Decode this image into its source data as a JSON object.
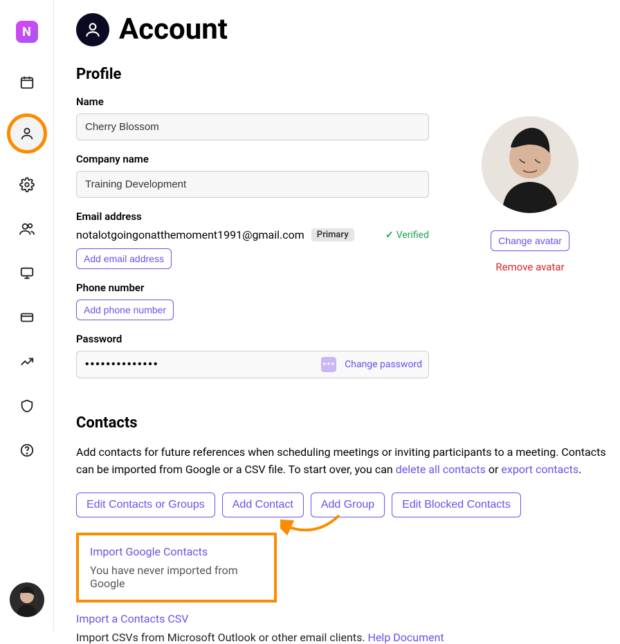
{
  "app": {
    "logo_letter": "N"
  },
  "page": {
    "title": "Account"
  },
  "profile": {
    "heading": "Profile",
    "name_label": "Name",
    "name_value": "Cherry Blossom",
    "company_label": "Company name",
    "company_value": "Training Development",
    "email_label": "Email address",
    "email_value": "notalotgoingonatthemoment1991@gmail.com",
    "email_badge": "Primary",
    "email_verified": "Verified",
    "add_email": "Add email address",
    "phone_label": "Phone number",
    "add_phone": "Add phone number",
    "password_label": "Password",
    "password_mask": "••••••••••••••",
    "change_password": "Change password",
    "change_avatar": "Change avatar",
    "remove_avatar": "Remove avatar"
  },
  "contacts": {
    "heading": "Contacts",
    "desc_part1": "Add contacts for future references when scheduling meetings or inviting participants to a meeting. Contacts can be imported from Google or a CSV file. To start over, you can ",
    "delete_link": "delete all contacts",
    "desc_part2": " or ",
    "export_link": "export contacts",
    "desc_part3": ".",
    "btn_edit": "Edit Contacts or Groups",
    "btn_add_contact": "Add Contact",
    "btn_add_group": "Add Group",
    "btn_blocked": "Edit Blocked Contacts",
    "import_google": "Import Google Contacts",
    "import_google_sub": "You have never imported from Google",
    "import_csv": "Import a Contacts CSV",
    "import_csv_sub": "Import CSVs from Microsoft Outlook or other email clients. ",
    "help_doc": "Help Document"
  }
}
